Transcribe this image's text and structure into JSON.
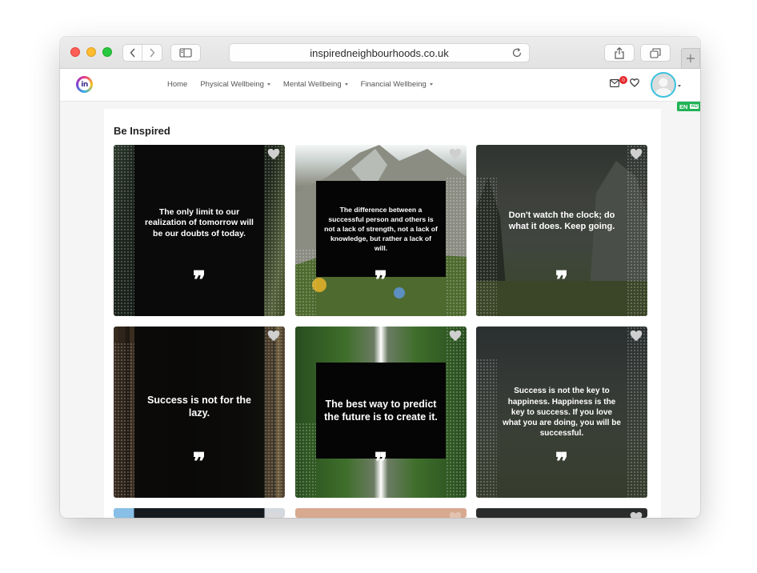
{
  "browser": {
    "url": "inspiredneighbourhoods.co.uk"
  },
  "header": {
    "logo_text": "in",
    "menu": [
      {
        "label": "Home",
        "dropdown": false
      },
      {
        "label": "Physical Wellbeing",
        "dropdown": true
      },
      {
        "label": "Mental Wellbeing",
        "dropdown": true
      },
      {
        "label": "Financial Wellbeing",
        "dropdown": true
      }
    ],
    "mail_badge": "0",
    "language": "EN",
    "language_badge": "AD"
  },
  "main": {
    "section_title": "Be Inspired",
    "quotes": [
      {
        "text": "The only limit to our realization of tomorrow will be our doubts of today."
      },
      {
        "text": "The difference between a successful person and others is not a lack of strength, not a lack of knowledge, but rather a lack of will."
      },
      {
        "text": "Don't watch the clock; do what it does. Keep going."
      },
      {
        "text": "Success is not for the lazy."
      },
      {
        "text": "The best way to predict the future is to create it."
      },
      {
        "text": "Success is not the key to happiness. Happiness is the key to success. If you love what you are doing, you will be successful."
      }
    ],
    "quote_mark": "❞"
  },
  "colors": {
    "accent": "#3cc3df",
    "badge_red": "#e3262b",
    "lang_green": "#21b356"
  }
}
